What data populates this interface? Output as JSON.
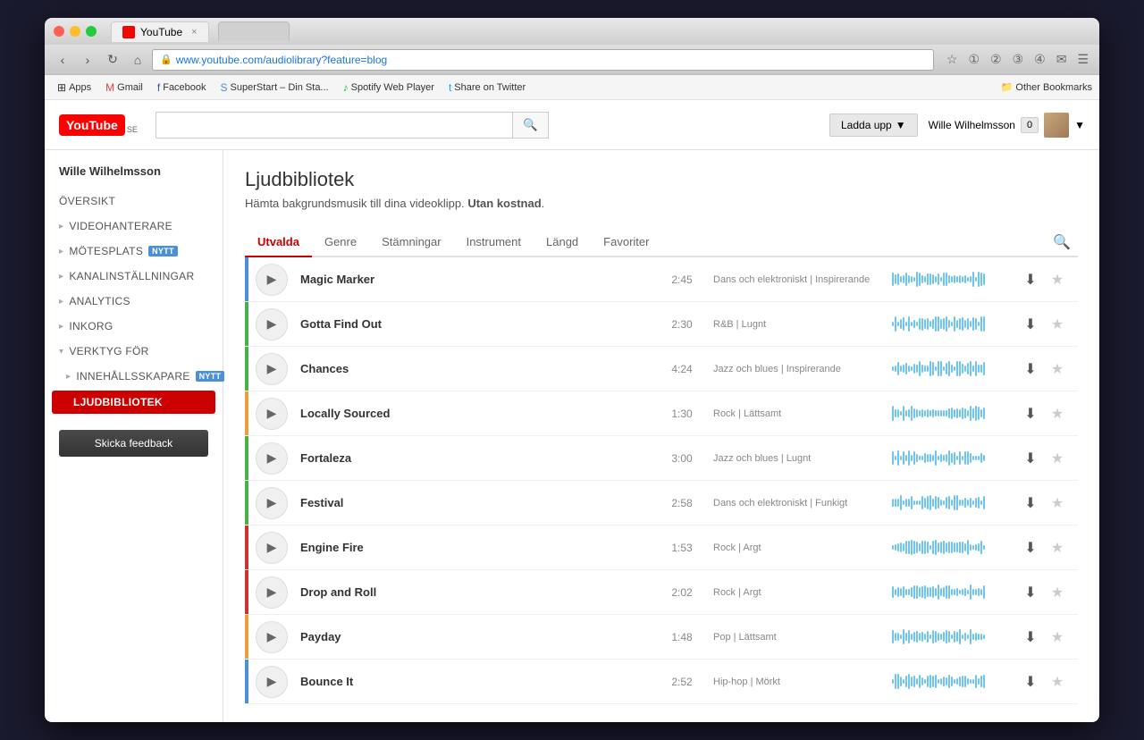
{
  "window": {
    "title": "YouTube",
    "url_base": "www.youtube.com",
    "url_path": "/audiolibrary?feature=blog",
    "buttons": {
      "close": "×",
      "minimize": "–",
      "maximize": "⬜"
    }
  },
  "toolbar": {
    "back": "‹",
    "forward": "›",
    "refresh": "↻",
    "home": "⌂",
    "bookmark_star": "☆",
    "extensions": "🧩",
    "menu": "☰"
  },
  "bookmarks": [
    {
      "id": "apps",
      "icon": "⊞",
      "label": "Apps"
    },
    {
      "id": "gmail",
      "icon": "✉",
      "label": "Gmail"
    },
    {
      "id": "facebook",
      "icon": "f",
      "label": "Facebook"
    },
    {
      "id": "superstart",
      "icon": "S",
      "label": "SuperStart – Din Sta..."
    },
    {
      "id": "spotify",
      "icon": "♪",
      "label": "Spotify Web Player"
    },
    {
      "id": "twitter",
      "icon": "t",
      "label": "Share on Twitter"
    }
  ],
  "other_bookmarks": "Other Bookmarks",
  "youtube": {
    "logo_text": "You",
    "logo_text2": "Tube",
    "logo_se": "SE",
    "upload_btn": "Ladda upp",
    "upload_arrow": "▼",
    "user_name": "Wille Wilhelmsson",
    "notification_count": "0"
  },
  "sidebar": {
    "username": "Wille Wilhelmsson",
    "items": [
      {
        "id": "oversikt",
        "label": "ÖVERSIKT",
        "arrow": false,
        "badge": null
      },
      {
        "id": "videohanterare",
        "label": "VIDEOHANTERARE",
        "arrow": true,
        "badge": null
      },
      {
        "id": "motesplats",
        "label": "MÖTESPLATS",
        "arrow": true,
        "badge": "NYTT"
      },
      {
        "id": "kanalinst",
        "label": "KANALINSTÄLLNINGAR",
        "arrow": true,
        "badge": null
      },
      {
        "id": "analytics",
        "label": "ANALYTICS",
        "arrow": true,
        "badge": null
      },
      {
        "id": "inkorg",
        "label": "INKORG",
        "arrow": true,
        "badge": null
      },
      {
        "id": "verktyg",
        "label": "VERKTYG FÖR",
        "arrow": false,
        "badge": null
      },
      {
        "id": "innehallsskapare",
        "label": "INNEHÅLLSSKAPARE",
        "arrow": true,
        "badge": "NYTT"
      },
      {
        "id": "ljudbibliotek",
        "label": "Ljudbibliotek",
        "active": true,
        "badge": null
      }
    ],
    "feedback_btn": "Skicka feedback"
  },
  "main": {
    "title": "Ljudbibliotek",
    "subtitle_normal": "Hämta bakgrundsmusik till dina videoklipp.",
    "subtitle_bold": "Utan kostnad",
    "subtitle_end": ".",
    "tabs": [
      {
        "id": "utvalda",
        "label": "Utvalda",
        "active": true
      },
      {
        "id": "genre",
        "label": "Genre",
        "active": false
      },
      {
        "id": "stamningar",
        "label": "Stämningar",
        "active": false
      },
      {
        "id": "instrument",
        "label": "Instrument",
        "active": false
      },
      {
        "id": "langd",
        "label": "Längd",
        "active": false
      },
      {
        "id": "favoriter",
        "label": "Favoriter",
        "active": false
      }
    ],
    "tracks": [
      {
        "id": 1,
        "name": "Magic Marker",
        "duration": "2:45",
        "tags": "Dans och elektroniskt | Inspirerande",
        "accent": "#4a90d9",
        "waveform_width": 110
      },
      {
        "id": 2,
        "name": "Gotta Find Out",
        "duration": "2:30",
        "tags": "R&B | Lugnt",
        "accent": "#4ab04a",
        "waveform_width": 65
      },
      {
        "id": 3,
        "name": "Chances",
        "duration": "4:24",
        "tags": "Jazz och blues | Inspirerande",
        "accent": "#4ab04a",
        "waveform_width": 70
      },
      {
        "id": 4,
        "name": "Locally Sourced",
        "duration": "1:30",
        "tags": "Rock | Lättsamt",
        "accent": "#e8a040",
        "waveform_width": 70
      },
      {
        "id": 5,
        "name": "Fortaleza",
        "duration": "3:00",
        "tags": "Jazz och blues | Lugnt",
        "accent": "#4ab04a",
        "waveform_width": 55
      },
      {
        "id": 6,
        "name": "Festival",
        "duration": "2:58",
        "tags": "Dans och elektroniskt | Funkigt",
        "accent": "#4ab04a",
        "waveform_width": 45
      },
      {
        "id": 7,
        "name": "Engine Fire",
        "duration": "1:53",
        "tags": "Rock | Argt",
        "accent": "#cc3333",
        "waveform_width": 55
      },
      {
        "id": 8,
        "name": "Drop and Roll",
        "duration": "2:02",
        "tags": "Rock | Argt",
        "accent": "#cc3333",
        "waveform_width": 55
      },
      {
        "id": 9,
        "name": "Payday",
        "duration": "1:48",
        "tags": "Pop | Lättsamt",
        "accent": "#e8a040",
        "waveform_width": 60
      },
      {
        "id": 10,
        "name": "Bounce It",
        "duration": "2:52",
        "tags": "Hip-hop | Mörkt",
        "accent": "#4a90d9",
        "waveform_width": 40
      }
    ]
  }
}
